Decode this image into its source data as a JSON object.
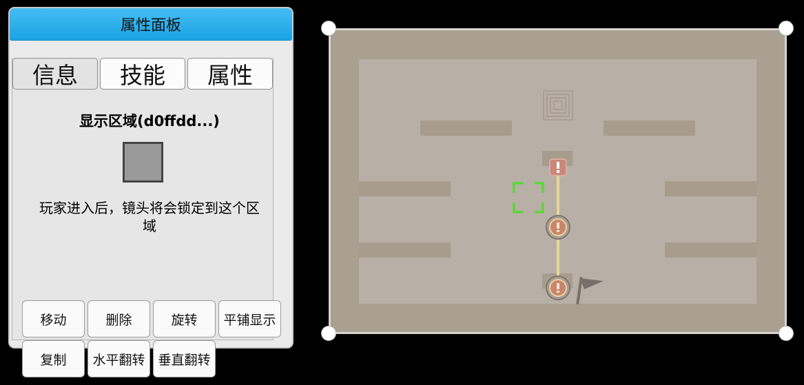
{
  "panel": {
    "title": "属性面板",
    "tabs": [
      {
        "label": "信息"
      },
      {
        "label": "技能"
      },
      {
        "label": "属性"
      }
    ],
    "region_title": "显示区域(d0ffdd...)",
    "swatch_color": "#9a9a9a",
    "description": "玩家进入后，镜头将会锁定到这个区域",
    "buttons": {
      "move": "移动",
      "delete": "删除",
      "rotate": "旋转",
      "tile_display": "平铺显示",
      "copy": "复制",
      "flip_horizontal": "水平翻转",
      "flip_vertical": "垂直翻转"
    }
  },
  "map": {
    "icons": [
      "maze-spiral-icon",
      "exclamation-marker-icon",
      "waypoint-icon",
      "flag-icon",
      "selection-bracket-icon"
    ],
    "colors": {
      "floor_outer": "#a9a092",
      "floor_inner": "#b8b0a6",
      "wall": "#a79c8e",
      "path_line": "#e8d796",
      "selection": "#4fdc2a"
    }
  }
}
